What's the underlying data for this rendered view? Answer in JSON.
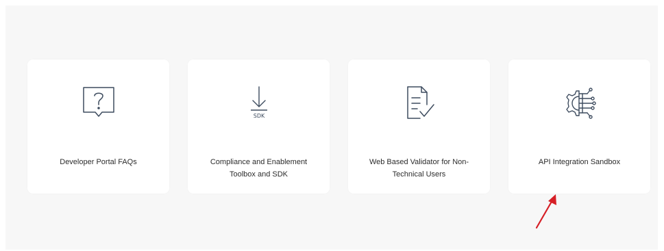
{
  "cards": [
    {
      "label": "Developer Portal FAQs",
      "icon": "question-bubble-icon"
    },
    {
      "label": "Compliance and Enablement Toolbox and SDK",
      "icon": "sdk-download-icon",
      "icon_text": "SDK"
    },
    {
      "label": "Web Based Validator for Non-Technical Users",
      "icon": "document-check-icon"
    },
    {
      "label": "API Integration Sandbox",
      "icon": "gear-circuit-icon"
    }
  ],
  "colors": {
    "icon_stroke": "#3d4b5e",
    "annotation_arrow": "#d61f26"
  }
}
